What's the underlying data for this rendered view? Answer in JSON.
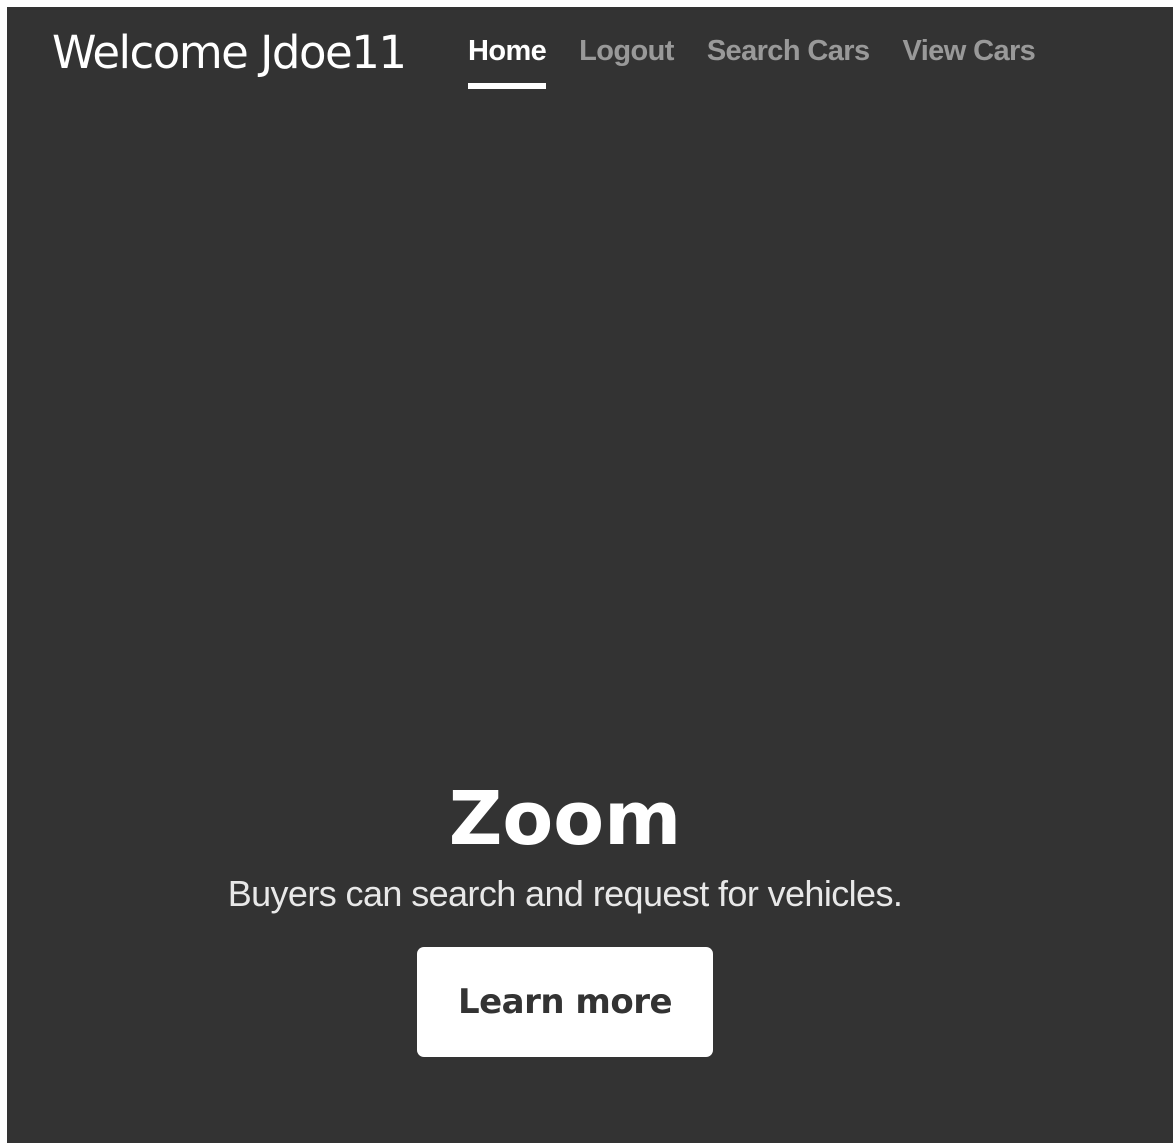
{
  "header": {
    "brand": "Welcome Jdoe11",
    "nav": [
      {
        "label": "Home",
        "active": true
      },
      {
        "label": "Logout",
        "active": false
      },
      {
        "label": "Search Cars",
        "active": false
      },
      {
        "label": "View Cars",
        "active": false
      }
    ]
  },
  "hero": {
    "title": "Zoom",
    "lead": "Buyers can search and request for vehicles.",
    "button_label": "Learn more"
  },
  "colors": {
    "background": "#333333",
    "text": "#ffffff",
    "nav_inactive": "rgba(255,255,255,0.5)",
    "button_bg": "#ffffff",
    "button_text": "#333333"
  }
}
